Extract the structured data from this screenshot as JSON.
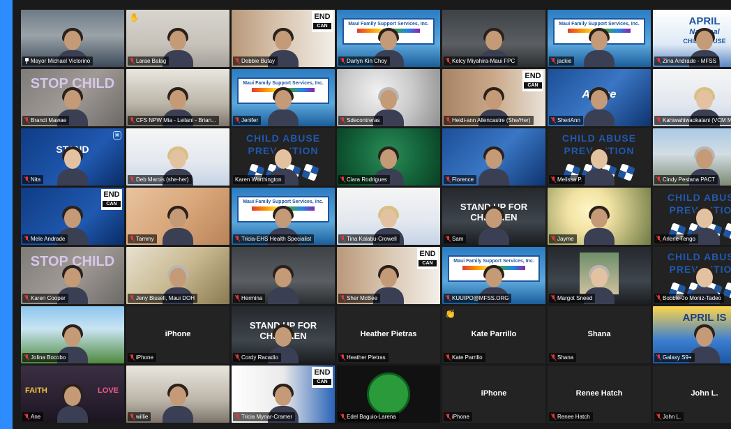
{
  "meeting": {
    "accent_color": "#2d8cff",
    "active_speaker_color": "#e8e356"
  },
  "tiles": [
    {
      "id": "victorino",
      "name": "Mayor Michael Victorino",
      "icon": "pin-icon",
      "bg": "room",
      "active": true
    },
    {
      "id": "balag",
      "name": "Larae Balag",
      "icon": "mute-icon",
      "bg": "wall",
      "reaction": "wave-emoji"
    },
    {
      "id": "butay",
      "name": "Debbie Butay",
      "icon": "mute-icon",
      "bg": "bear",
      "end": "END"
    },
    {
      "id": "choy",
      "name": "Darlyn Kin Choy",
      "icon": "mute-icon",
      "bg": "mfss"
    },
    {
      "id": "miyahira",
      "name": "Kelcy Miyahira-Maui FPC",
      "icon": "mute-icon",
      "bg": "office"
    },
    {
      "id": "jackie",
      "name": "jackie",
      "icon": "mute-icon",
      "bg": "mfss"
    },
    {
      "id": "andrade",
      "name": "Zina Andrade - MFSS",
      "icon": "mute-icon",
      "bg": "april",
      "banner": "APRIL",
      "banner2": "National",
      "banner3": "CHILD ABUSE"
    },
    {
      "id": "mawae",
      "name": "Brandi Mawae",
      "icon": "mute-icon",
      "bg": "chalk",
      "chalk": "STOP CHILD"
    },
    {
      "id": "cfs",
      "name": "CFS NPW Mia - Leilani - Brian...",
      "icon": "mute-icon",
      "bg": "ceiling"
    },
    {
      "id": "jenifer",
      "name": "Jenifer",
      "icon": "mute-icon",
      "bg": "mfss"
    },
    {
      "id": "decontreras",
      "name": "Sdecontreras",
      "icon": "mute-icon",
      "bg": "glitter"
    },
    {
      "id": "allencastre",
      "name": "Heidi-ann Allencastre (She/Her)",
      "icon": "mute-icon",
      "bg": "bear-dark",
      "end": "END"
    },
    {
      "id": "sheriann",
      "name": "SheriAnn",
      "icon": "mute-icon",
      "bg": "pinwheel",
      "banner": "Abuse"
    },
    {
      "id": "kahiwahiwa",
      "name": "Kahiwahiwaokalani (VCM M...",
      "icon": "mute-icon",
      "bg": "pinwheel-w"
    },
    {
      "id": "nita",
      "name": "Nita",
      "icon": "mute-icon",
      "bg": "stand",
      "stand": "STAND"
    },
    {
      "id": "marois",
      "name": "Deb Marois (she-her)",
      "icon": "mute-icon",
      "bg": "pinwheel-w"
    },
    {
      "id": "worthington",
      "name": "Karen Worthington",
      "icon": "none",
      "bg": "cap",
      "cap": "CHILD ABUSE",
      "cap2": "PREVENTION"
    },
    {
      "id": "rodrigues",
      "name": "Ciara Rodrigues",
      "icon": "mute-icon",
      "bg": "green"
    },
    {
      "id": "florence",
      "name": "Florence",
      "icon": "mute-icon",
      "bg": "pinwheel"
    },
    {
      "id": "melissa",
      "name": "Melissa P.",
      "icon": "mute-icon",
      "bg": "cap",
      "cap": "CHILD ABUSE",
      "cap2": "PREVENTION"
    },
    {
      "id": "pestana",
      "name": "Cindy Pestana PACT",
      "icon": "mute-icon",
      "bg": "outdoor"
    },
    {
      "id": "mele",
      "name": "Mele Andrade",
      "icon": "mute-icon",
      "bg": "stand",
      "end": "END"
    },
    {
      "id": "tammy",
      "name": "Tammy",
      "icon": "mute-icon",
      "bg": "skin"
    },
    {
      "id": "tricia-ehs",
      "name": "Tricia-EHS Health Specialist",
      "icon": "mute-icon",
      "bg": "mfss"
    },
    {
      "id": "tina",
      "name": "Tina Kalabu-Crowell",
      "icon": "mute-icon",
      "bg": "pinwheel-w"
    },
    {
      "id": "sam",
      "name": "Sam",
      "icon": "mute-icon",
      "bg": "dark",
      "poster": "STAND UP FOR CHILDREN"
    },
    {
      "id": "jayme",
      "name": "Jayme",
      "icon": "mute-icon",
      "bg": "plumeria"
    },
    {
      "id": "tengo",
      "name": "Arlene Tengo",
      "icon": "mute-icon",
      "bg": "cap",
      "cap": "CHILD ABUSE",
      "cap2": "PREVENTION"
    },
    {
      "id": "cooper",
      "name": "Karen Cooper",
      "icon": "mute-icon",
      "bg": "chalk",
      "chalk": "STOP CHILD"
    },
    {
      "id": "bissell",
      "name": "Jeny Bissell, Maui DOH",
      "icon": "mute-icon",
      "bg": "mural"
    },
    {
      "id": "hermina",
      "name": "Hermina",
      "icon": "mute-icon",
      "bg": "office"
    },
    {
      "id": "mcbee",
      "name": "Sher McBee",
      "icon": "mute-icon",
      "bg": "bear",
      "end": "END"
    },
    {
      "id": "kuuipo",
      "name": "KUUIPO@MFSS.ORG",
      "icon": "mute-icon",
      "bg": "mfss"
    },
    {
      "id": "sneed",
      "name": "Margot Sneed",
      "icon": "mute-icon",
      "bg": "no-video-dark"
    },
    {
      "id": "moniz",
      "name": "Bobbie-Jo Moniz-Tadeo",
      "icon": "mute-icon",
      "bg": "cap",
      "cap": "CHILD ABUSE",
      "cap2": "PREVENTION"
    },
    {
      "id": "bocobo",
      "name": "Jolina Bocobo",
      "icon": "mute-icon",
      "bg": "beach"
    },
    {
      "id": "iphone1",
      "name": "iPhone",
      "icon": "mute-icon",
      "bg": "none",
      "center": "iPhone"
    },
    {
      "id": "racadio",
      "name": "Cordy Racadio",
      "icon": "mute-icon",
      "bg": "dark",
      "poster": "STAND UP FOR CHILDREN"
    },
    {
      "id": "pietras",
      "name": "Heather Pietras",
      "icon": "mute-icon",
      "bg": "none",
      "center": "Heather Pietras"
    },
    {
      "id": "parrillo",
      "name": "Kate Parrillo",
      "icon": "mute-icon",
      "bg": "none",
      "center": "Kate Parrillo",
      "reaction": "clap-emoji"
    },
    {
      "id": "shana",
      "name": "Shana",
      "icon": "mute-icon",
      "bg": "none",
      "center": "Shana"
    },
    {
      "id": "galaxy",
      "name": "Galaxy S9+",
      "icon": "mute-icon",
      "bg": "aprilis",
      "banner": "APRIL IS"
    },
    {
      "id": "ane",
      "name": "Ane",
      "icon": "mute-icon",
      "bg": "faith",
      "faith": "FAITH",
      "love": "LOVE"
    },
    {
      "id": "willie",
      "name": "willie",
      "icon": "mute-icon",
      "bg": "ceiling"
    },
    {
      "id": "mynar",
      "name": "Tricia Mynar-Cramer",
      "icon": "mute-icon",
      "bg": "endblue",
      "end": "END"
    },
    {
      "id": "baguio",
      "name": "Edel Baguio-Larena",
      "icon": "mute-icon",
      "bg": "logo"
    },
    {
      "id": "iphone2",
      "name": "iPhone",
      "icon": "mute-icon",
      "bg": "none",
      "center": "iPhone"
    },
    {
      "id": "hatch",
      "name": "Renee Hatch",
      "icon": "mute-icon",
      "bg": "none",
      "center": "Renee Hatch"
    },
    {
      "id": "johnl",
      "name": "John L.",
      "icon": "mute-icon",
      "bg": "none",
      "center": "John L."
    }
  ],
  "strings": {
    "end_top": "END",
    "end_bottom": "CAN",
    "mfss_title": "Maui Family Support Services, Inc."
  }
}
